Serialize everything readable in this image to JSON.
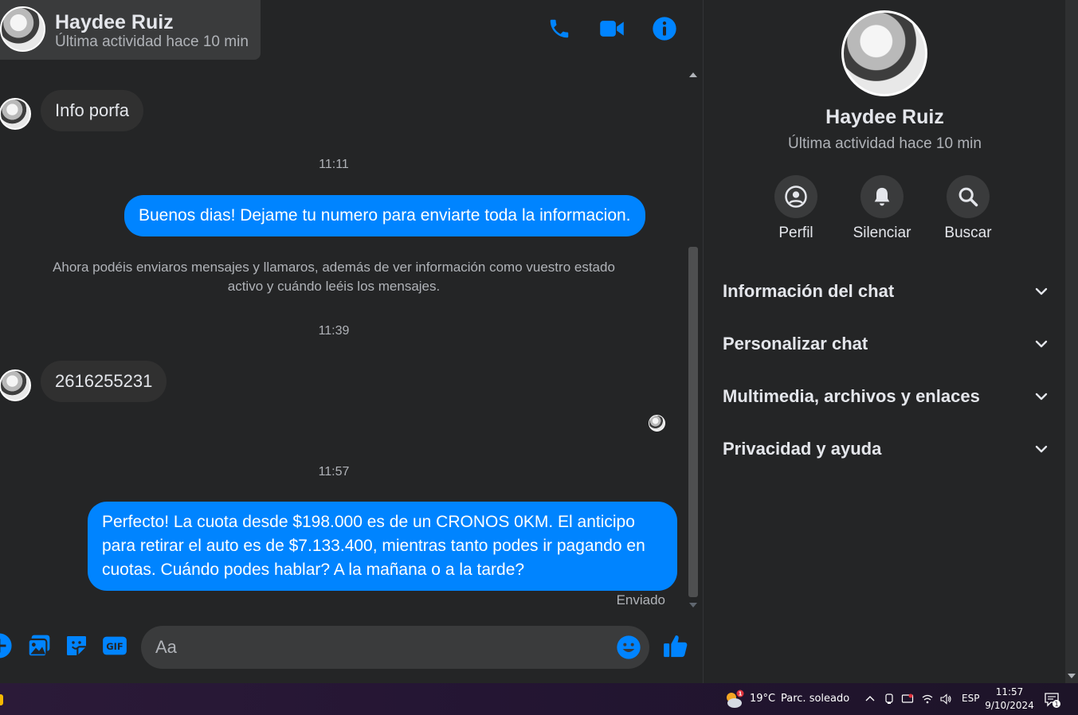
{
  "contact": {
    "name": "Haydee Ruiz",
    "status": "Última actividad hace 10 min"
  },
  "header_icons": {
    "call": "phone-icon",
    "video": "video-camera-icon",
    "info": "info-icon"
  },
  "messages": {
    "m1": {
      "direction": "incoming",
      "text": "Info porfa"
    },
    "t1": "11:11",
    "m2": {
      "direction": "outgoing",
      "text": "Buenos dias! Dejame tu numero para enviarte toda la informacion."
    },
    "notice": "Ahora podéis enviaros mensajes y llamaros, además de ver información como vuestro estado activo y cuándo leéis los mensajes.",
    "t2": "11:39",
    "m3": {
      "direction": "incoming",
      "text": "2616255231"
    },
    "t3": "11:57",
    "m4": {
      "direction": "outgoing",
      "text": "Perfecto! La cuota desde $198.000 es de un CRONOS 0KM. El anticipo para retirar el auto es de $7.133.400, mientras tanto podes ir pagando en cuotas. Cuándo podes hablar? A la mañana o a la tarde?"
    },
    "sent_status": "Enviado"
  },
  "composer": {
    "placeholder": "Aa",
    "icons": [
      "plus-icon",
      "image-icon",
      "sticker-icon",
      "gif-icon",
      "emoji-icon",
      "like-icon"
    ]
  },
  "panel": {
    "name": "Haydee Ruiz",
    "status": "Última actividad hace 10 min",
    "actions": {
      "profile": "Perfil",
      "mute": "Silenciar",
      "search": "Buscar"
    },
    "sections": {
      "chat_info": "Información del chat",
      "customize": "Personalizar chat",
      "media": "Multimedia, archivos y enlaces",
      "privacy": "Privacidad y ayuda"
    }
  },
  "taskbar": {
    "weather_badge": "1",
    "temperature": "19°C",
    "weather": "Parc. soleado",
    "language": "ESP",
    "time": "11:57",
    "date": "9/10/2024",
    "notifications": "1"
  },
  "colors": {
    "accent": "#0084ff",
    "background": "#242526",
    "incoming_bubble": "#303030",
    "surface": "#3a3b3c"
  }
}
